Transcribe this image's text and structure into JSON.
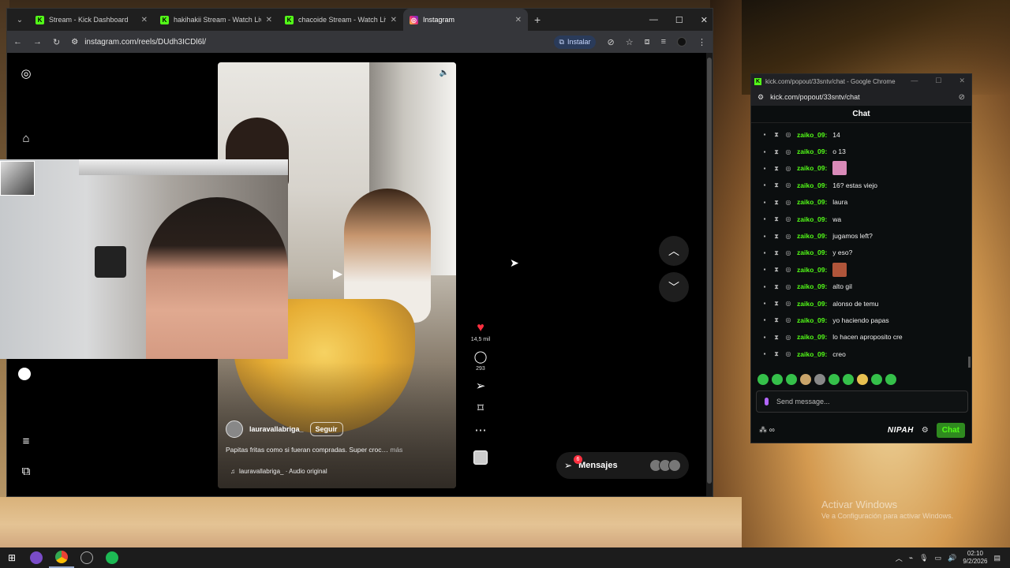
{
  "browser": {
    "tabs": [
      {
        "title": "Stream - Kick Dashboard",
        "favicon": "kick-icon",
        "active": false
      },
      {
        "title": "hakihakii Stream - Watch Live o",
        "favicon": "kick-icon",
        "active": false
      },
      {
        "title": "chacoide Stream - Watch Live o",
        "favicon": "kick-icon",
        "active": false
      },
      {
        "title": "Instagram",
        "favicon": "instagram-icon",
        "active": true
      }
    ],
    "url": "instagram.com/reels/DUdh3ICDl6l/",
    "install_label": "Instalar"
  },
  "reel": {
    "username": "lauravallabriga_",
    "follow_label": "Seguir",
    "caption": "Papitas fritas como si fueran compradas. Super croc…",
    "more_label": "más",
    "audio": "lauravallabriga_ · Audio original",
    "likes": "14,5 mil",
    "comments": "293"
  },
  "messages": {
    "label": "Mensajes",
    "badge": "6"
  },
  "chat": {
    "window_title": "kick.com/popout/33sntv/chat - Google Chrome",
    "url": "kick.com/popout/33sntv/chat",
    "header": "Chat",
    "messages": [
      {
        "user": "zaiko_09:",
        "text": "14"
      },
      {
        "user": "zaiko_09:",
        "text": "o 13"
      },
      {
        "user": "zaiko_09:",
        "text": "",
        "emote": "#d98ab8"
      },
      {
        "user": "zaiko_09:",
        "text": "16? estas viejo"
      },
      {
        "user": "zaiko_09:",
        "text": "laura"
      },
      {
        "user": "zaiko_09:",
        "text": "wa"
      },
      {
        "user": "zaiko_09:",
        "text": "jugamos left?"
      },
      {
        "user": "zaiko_09:",
        "text": "y eso?"
      },
      {
        "user": "zaiko_09:",
        "text": "",
        "emote": "#b0553a"
      },
      {
        "user": "zaiko_09:",
        "text": "alto gil"
      },
      {
        "user": "zaiko_09:",
        "text": "alonso de temu"
      },
      {
        "user": "zaiko_09:",
        "text": "yo haciendo papas"
      },
      {
        "user": "zaiko_09:",
        "text": "lo hacen aproposito cre"
      },
      {
        "user": "zaiko_09:",
        "text": "creo"
      }
    ],
    "send_placeholder": "Send message...",
    "nipah_label": "NIPAH",
    "chat_button": "Chat"
  },
  "desktop": {
    "activate_title": "Activar Windows",
    "activate_sub": "Ve a Configuración para activar Windows."
  },
  "taskbar": {
    "time": "02:10",
    "date": "9/2/2026"
  },
  "colors": {
    "kick_green": "#53fc18",
    "like_red": "#ff3040"
  }
}
